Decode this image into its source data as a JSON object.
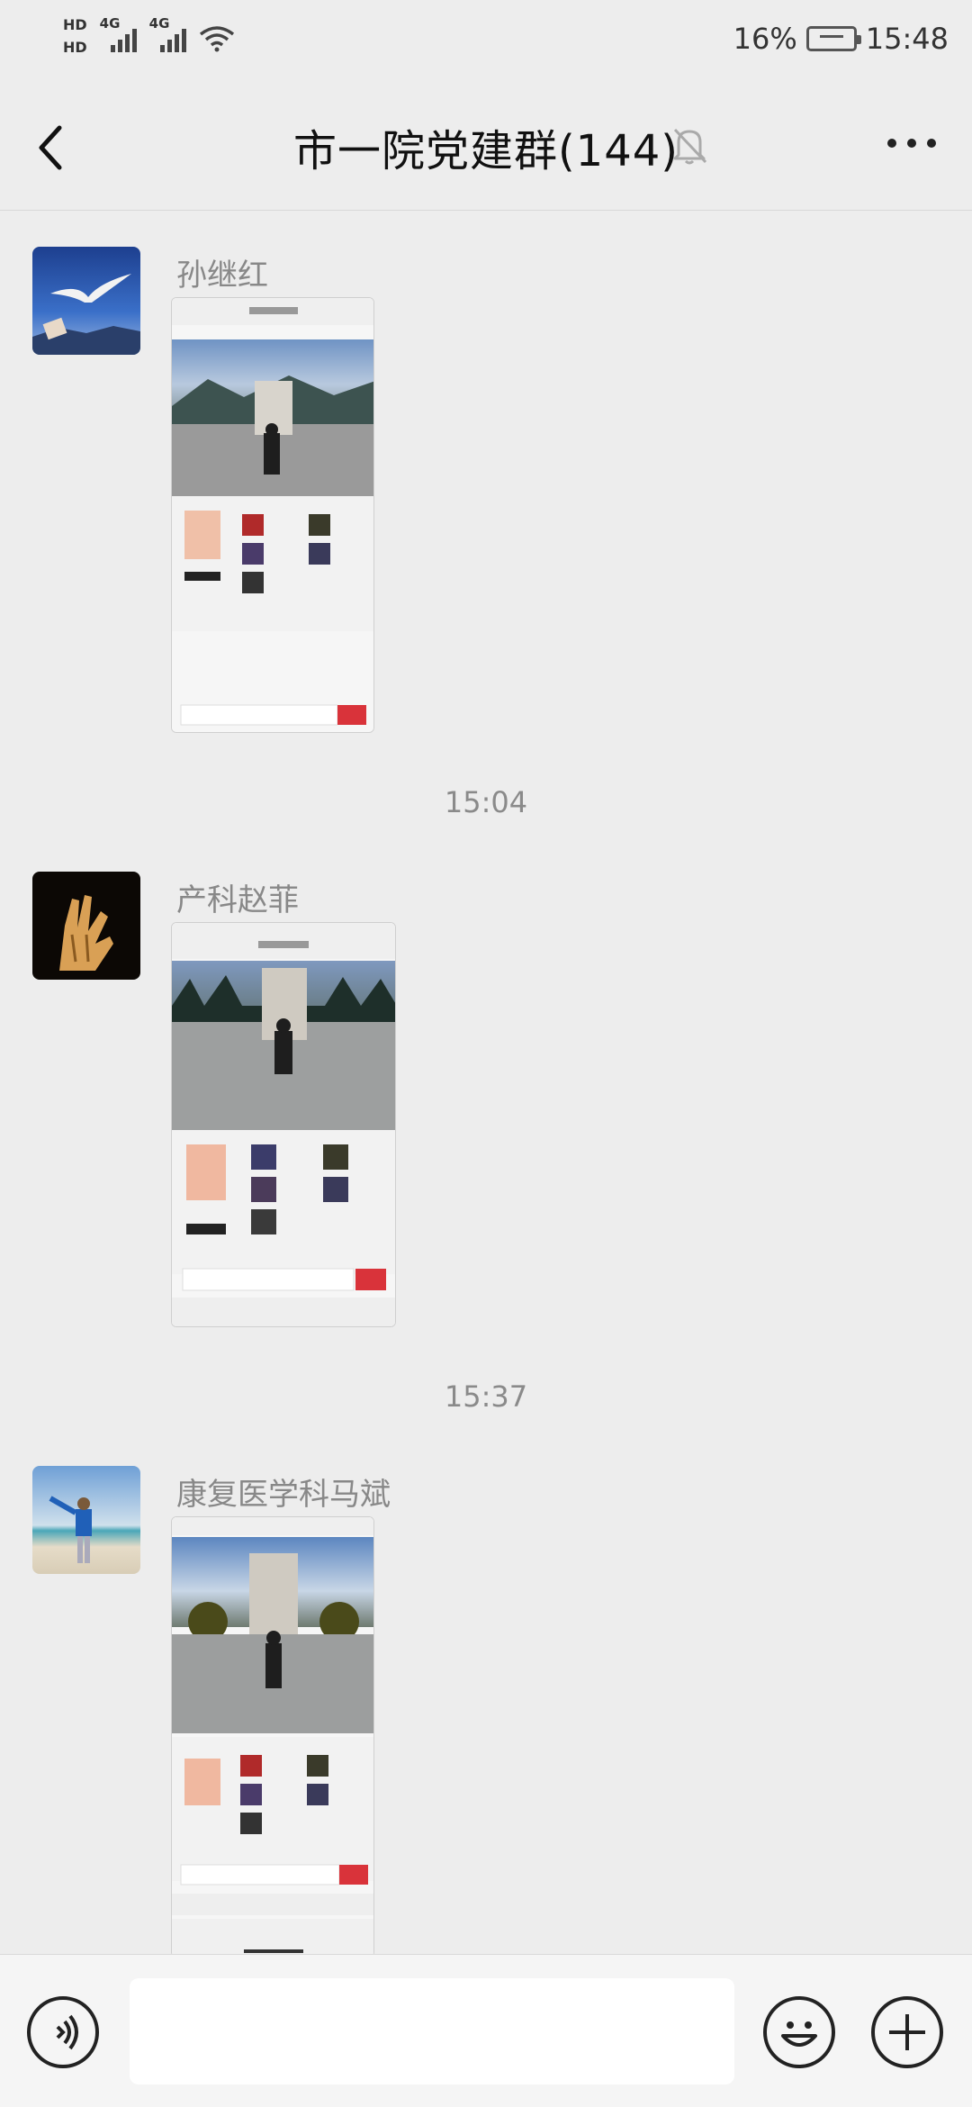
{
  "status_bar": {
    "hd1": "HD",
    "hd2": "HD",
    "net1": "4G",
    "net2": "4G",
    "battery": "16%",
    "time": "15:48"
  },
  "chat": {
    "title": "市一院党建群(144)"
  },
  "messages": [
    {
      "sender": "孙继红",
      "type": "image"
    },
    {
      "timestamp": "15:04"
    },
    {
      "sender": "产科赵菲",
      "type": "image"
    },
    {
      "timestamp": "15:37"
    },
    {
      "sender": "康复医学科马斌",
      "type": "image"
    }
  ],
  "icons": {
    "back": "back-arrow-icon",
    "mute": "bell-muted-icon",
    "more": "more-dots-icon",
    "voice": "voice-icon",
    "emoji": "emoji-icon",
    "plus": "plus-icon"
  },
  "colors": {
    "background": "#ededed",
    "bottom_bar": "#f5f5f5",
    "accent_red": "#d9333a"
  }
}
